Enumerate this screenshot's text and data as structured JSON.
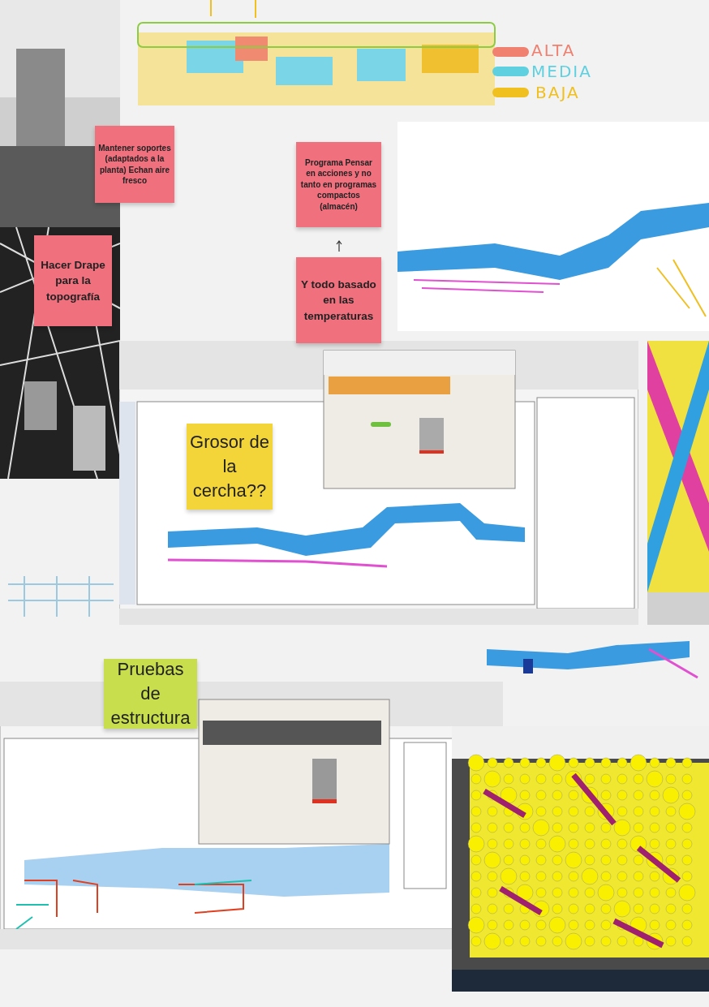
{
  "board": {
    "legend": [
      {
        "text": "ALTA",
        "color": "#f08070"
      },
      {
        "text": "MEDIA",
        "color": "#5fd0e0"
      },
      {
        "text": "BAJA",
        "color": "#f0c020"
      }
    ],
    "notes": [
      {
        "text": "Mantener soportes (adaptados a la planta) Echan aire fresco",
        "color": "#f0707e",
        "kind": "small"
      },
      {
        "text": "Hacer Drape para la topografía",
        "color": "#f0707e",
        "kind": "medium"
      },
      {
        "text": "Programa Pensar en acciones y no tanto en programas compactos (almacén)",
        "color": "#f0707e",
        "kind": "small"
      },
      {
        "text": "Y todo basado en las temperaturas",
        "color": "#f0707e",
        "kind": "medium"
      },
      {
        "text": "Grosor de la cercha??",
        "color": "#f3d53a",
        "kind": "large"
      },
      {
        "text": "Pruebas de estructura",
        "color": "#c8de4c",
        "kind": "large"
      }
    ]
  }
}
